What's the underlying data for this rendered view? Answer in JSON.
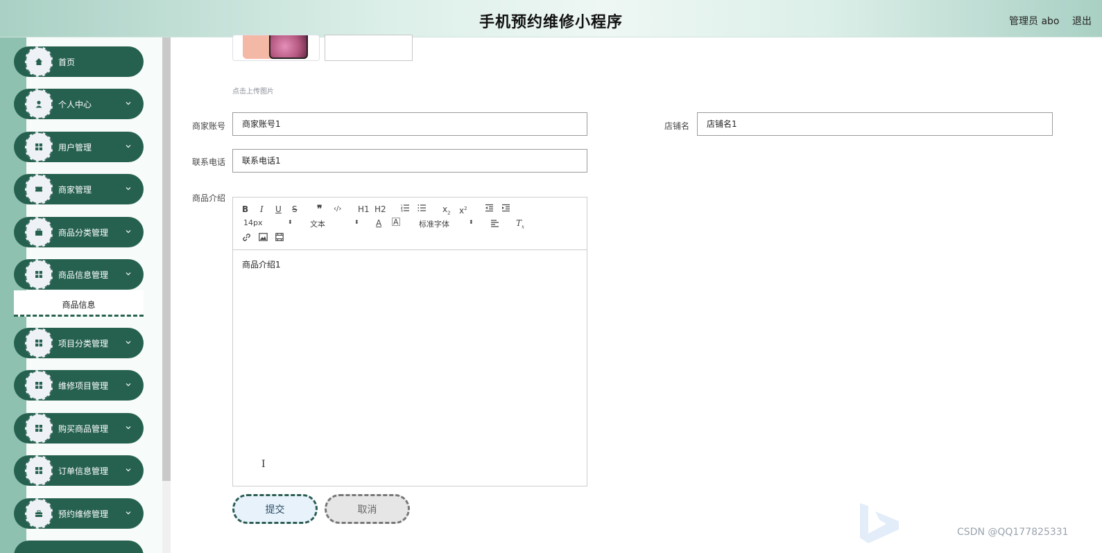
{
  "header": {
    "title": "手机预约维修小程序",
    "user_label": "管理员 abo",
    "logout_label": "退出"
  },
  "sidebar": {
    "items": [
      {
        "label": "首页",
        "icon": "home-icon",
        "has_chevron": false
      },
      {
        "label": "个人中心",
        "icon": "user-icon",
        "has_chevron": true
      },
      {
        "label": "用户管理",
        "icon": "grid-icon",
        "has_chevron": true
      },
      {
        "label": "商家管理",
        "icon": "ticket-icon",
        "has_chevron": true
      },
      {
        "label": "商品分类管理",
        "icon": "briefcase-icon",
        "has_chevron": true
      },
      {
        "label": "商品信息管理",
        "icon": "grid-icon",
        "has_chevron": true
      },
      {
        "label": "项目分类管理",
        "icon": "grid-icon",
        "has_chevron": true
      },
      {
        "label": "维修项目管理",
        "icon": "grid-icon",
        "has_chevron": true
      },
      {
        "label": "购买商品管理",
        "icon": "grid-icon",
        "has_chevron": true
      },
      {
        "label": "订单信息管理",
        "icon": "grid-icon",
        "has_chevron": true
      },
      {
        "label": "预约维修管理",
        "icon": "toolbox-icon",
        "has_chevron": true
      }
    ],
    "active_subitem": "商品信息"
  },
  "form": {
    "upload_hint": "点击上传图片",
    "merchant_account_label": "商家账号",
    "merchant_account_value": "商家账号1",
    "shop_name_label": "店铺名",
    "shop_name_value": "店铺名1",
    "phone_label": "联系电话",
    "phone_value": "联系电话1",
    "intro_label": "商品介绍",
    "intro_content": "商品介绍1"
  },
  "editor_toolbar": {
    "font_size": "14px",
    "text_style": "文本",
    "font_family": "标准字体",
    "h1": "H1",
    "h2": "H2"
  },
  "buttons": {
    "submit": "提交",
    "cancel": "取消"
  },
  "watermark": "CSDN @QQ177825331",
  "colors": {
    "sidebar_item": "#26614f",
    "header_gradient_edge": "#a9d0c4",
    "submit_bg": "#e7f2fb",
    "cancel_bg": "#e6e6e6"
  }
}
